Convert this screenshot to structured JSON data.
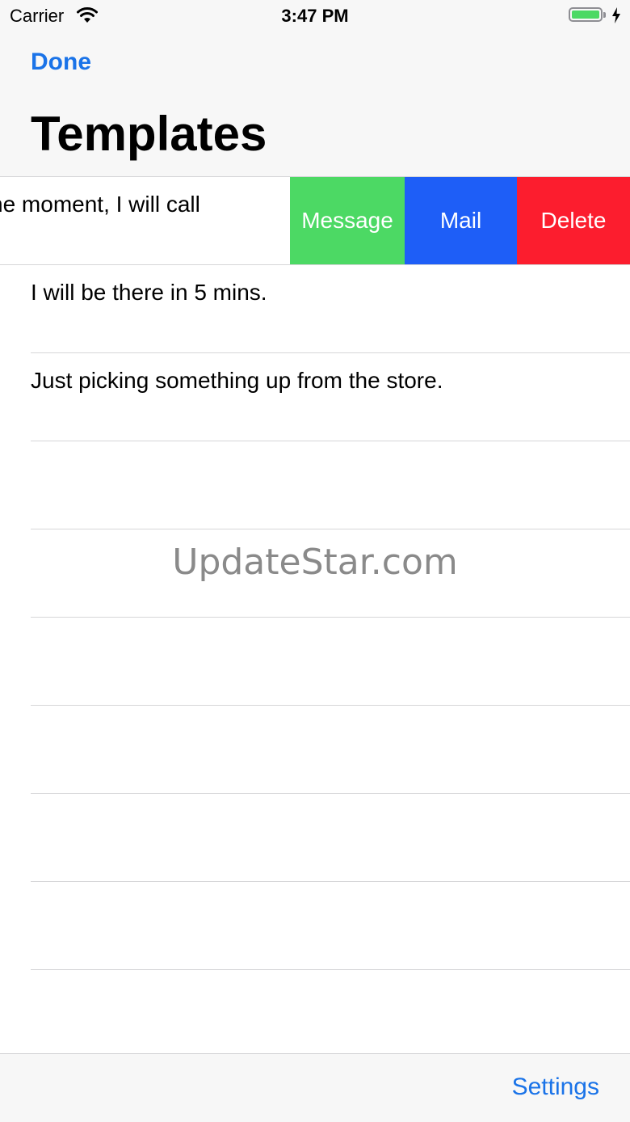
{
  "status_bar": {
    "carrier": "Carrier",
    "time": "3:47 PM",
    "wifi_icon": "wifi-icon",
    "battery_icon": "battery-icon",
    "charging_icon": "charging-bolt-icon",
    "battery_level": 1.0
  },
  "nav": {
    "done_label": "Done",
    "title": "Templates"
  },
  "templates": [
    {
      "text": "ne moment, I will call",
      "swipe_actions": [
        {
          "label": "Message",
          "color": "#4cd964"
        },
        {
          "label": "Mail",
          "color": "#1e5ef7"
        },
        {
          "label": "Delete",
          "color": "#fc1d2e"
        }
      ]
    },
    {
      "text": "I will be there in 5 mins."
    },
    {
      "text": "Just picking something up from the store."
    },
    {
      "text": ""
    },
    {
      "text": ""
    },
    {
      "text": ""
    },
    {
      "text": ""
    },
    {
      "text": ""
    },
    {
      "text": ""
    },
    {
      "text": ""
    }
  ],
  "watermark": "UpdateStar.com",
  "toolbar": {
    "settings_label": "Settings"
  },
  "colors": {
    "accent": "#1a73e8",
    "message": "#4cd964",
    "mail": "#1e5ef7",
    "delete": "#fc1d2e"
  }
}
